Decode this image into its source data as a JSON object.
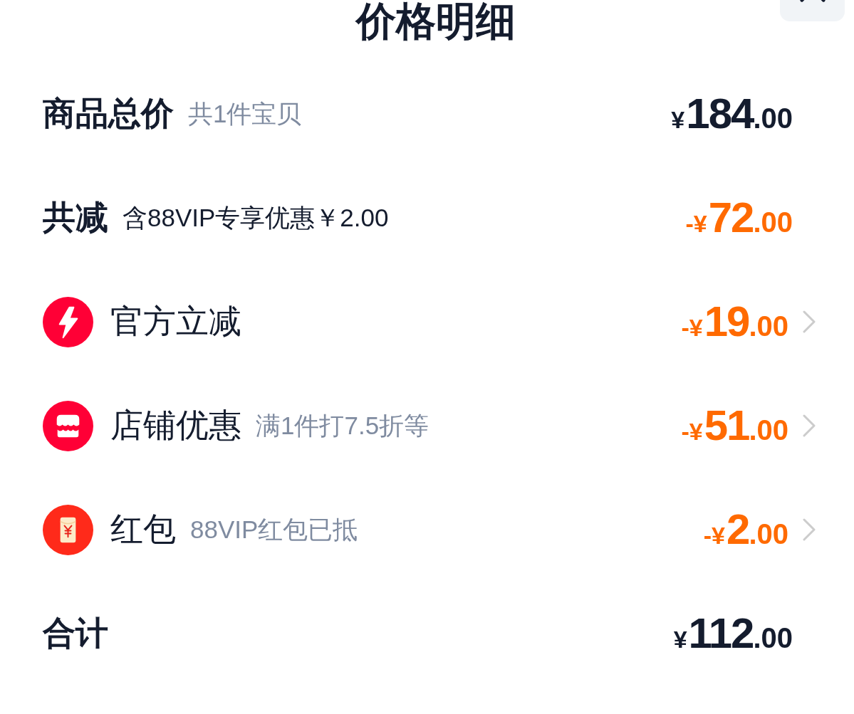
{
  "header": {
    "title": "价格明细"
  },
  "rows": [
    {
      "kind": "summary",
      "label": "商品总价",
      "note": {
        "text": "共1件宝贝",
        "muted": true
      },
      "amount": {
        "prefix": "¥",
        "integer": "184",
        "fraction": ".00"
      },
      "highlight": false
    },
    {
      "kind": "summary",
      "label": "共减",
      "note": {
        "text": "含88VIP专享优惠￥2.00",
        "muted": false
      },
      "amount": {
        "prefix": "-¥",
        "integer": "72",
        "fraction": ".00"
      },
      "highlight": true
    },
    {
      "kind": "official-discount",
      "label": "官方立减",
      "amount": {
        "prefix": "-¥",
        "integer": "19",
        "fraction": ".00"
      },
      "highlight": true
    },
    {
      "kind": "store-discount",
      "label": "店铺优惠",
      "note": {
        "text": "满1件打7.5折等",
        "muted": true
      },
      "amount": {
        "prefix": "-¥",
        "integer": "51",
        "fraction": ".00"
      },
      "highlight": true
    },
    {
      "kind": "red-packet",
      "label": "红包",
      "note": {
        "text": "88VIP红包已抵",
        "muted": true
      },
      "amount": {
        "prefix": "-¥",
        "integer": "2",
        "fraction": ".00"
      },
      "highlight": true
    },
    {
      "kind": "summary",
      "label": "合计",
      "amount": {
        "prefix": "¥",
        "integer": "112",
        "fraction": ".00"
      },
      "highlight": false
    }
  ]
}
